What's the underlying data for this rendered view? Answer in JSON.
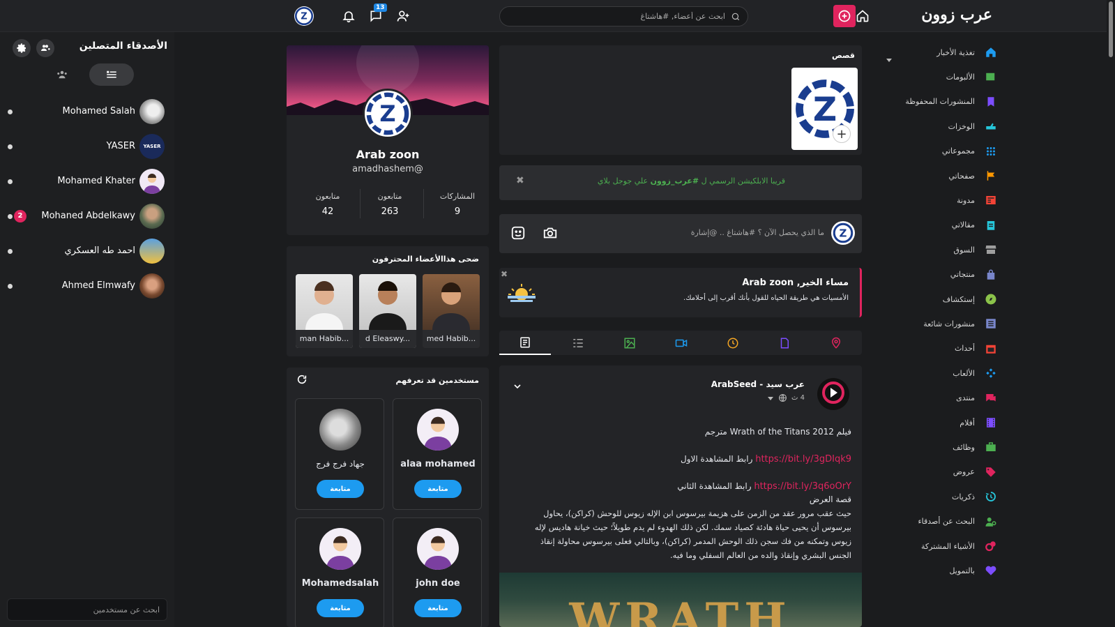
{
  "topbar": {
    "logo": "عرب زوون",
    "search_placeholder": "ابحث عن أعضاء, #هاشتاغ",
    "messages_count": "13"
  },
  "colors": {
    "accent": "#e0245e",
    "blue": "#1d9bf0",
    "bg": "#1b1c1e",
    "card": "#232427"
  },
  "left_sidebar": {
    "title": "الأصدقاء المتصلين",
    "search_placeholder": "ابحث عن مستخدمين",
    "friends": [
      {
        "name": "Mohamed Salah",
        "unread": ""
      },
      {
        "name": "YASER",
        "unread": ""
      },
      {
        "name": "Mohamed Khater",
        "unread": ""
      },
      {
        "name": "Mohaned Abdelkawy",
        "unread": "2"
      },
      {
        "name": "احمد طه العسكري",
        "unread": ""
      },
      {
        "name": "Ahmed Elmwafy",
        "unread": ""
      }
    ]
  },
  "profile": {
    "name": "Arab zoon",
    "handle": "amadhashem@",
    "stats": [
      {
        "label": "المشاركات",
        "value": "9"
      },
      {
        "label": "متابعون",
        "value": "263"
      },
      {
        "label": "متابعون",
        "value": "42"
      }
    ]
  },
  "featured": {
    "title": "ضحى هذاالأعضاء المحترفون",
    "members": [
      "med Habib...",
      "d Eleaswy...",
      "man Habib..."
    ]
  },
  "suggestions": {
    "title": "مستخدمين قد تعرفهم",
    "follow_label": "متابعة",
    "users": [
      "alaa mohamed",
      "جهاد فرج فرج",
      "john doe",
      "Mohamedsalah"
    ]
  },
  "stories": {
    "title": "قصص"
  },
  "announcement": {
    "prefix": "قريبا الابلكيشن الرسمي ل",
    "hashtag": "#عرب_زوون",
    "suffix": "علي جوجل بلاي"
  },
  "composer": {
    "placeholder": "ما الذي يحصل الآن ؟ #هاشتاغ .. @إشارة"
  },
  "greeting": {
    "title": "مساء الخير, Arab zoon",
    "quote": "الأمسيات هي طريقة الحياه للقول بأنك أقرب إلى أحلامك."
  },
  "post": {
    "author": "عرب سيد - ArabSeed",
    "time": "4 ث",
    "line1": "فيلم Wrath of the Titans 2012 مترجم",
    "link1_label": "رابط المشاهدة الاول",
    "link1": "https://bit.ly/3gDIqk9",
    "link2_label": "رابط المشاهدة الثاني",
    "link2": "https://bit.ly/3q6oOrY",
    "story_title": "قصة العرض",
    "story": "حيث عقب مرور عقد من الزمن على هزيمة بيرسوس ابن الإله زيوس للوحش (كراكن)، يحاول بيرسوس أن يحيى حياة هادئة كصياد سمك. لكن ذلك الهدوء لم يدم طويلاً؛ حيث خيانة هاديس لإله زيوس وتمكنه من فك سجن ذلك الوحش المدمر (كراكن)، وبالتالي فعلى بيرسوس محاولة إنقاذ الجنس البشري وإنقاذ والده من العالم السفلي وما فيه.",
    "image_text": "WRATH"
  },
  "right_nav": [
    {
      "label": "تغذية الأخبار",
      "icon": "home-icon",
      "color": "#1d9bf0"
    },
    {
      "label": "الألبومات",
      "icon": "album-icon",
      "color": "#4caf50"
    },
    {
      "label": "المنشورات المحفوظة",
      "icon": "bookmark-icon",
      "color": "#7c4dff"
    },
    {
      "label": "الوخزات",
      "icon": "poke-icon",
      "color": "#26c6da"
    },
    {
      "label": "مجموعاتي",
      "icon": "groups-icon",
      "color": "#1d9bf0"
    },
    {
      "label": "صفحاتي",
      "icon": "flag-icon",
      "color": "#ff9800"
    },
    {
      "label": "مدونة",
      "icon": "blog-icon",
      "color": "#f44336"
    },
    {
      "label": "مقالاتي",
      "icon": "clipboard-icon",
      "color": "#26c6da"
    },
    {
      "label": "السوق",
      "icon": "store-icon",
      "color": "#9e9e9e"
    },
    {
      "label": "منتجاتي",
      "icon": "bag-icon",
      "color": "#7986cb"
    },
    {
      "label": "إستكشاف",
      "icon": "compass-icon",
      "color": "#8bc34a"
    },
    {
      "label": "منشورات شائعة",
      "icon": "list-icon",
      "color": "#7986cb"
    },
    {
      "label": "أحداث",
      "icon": "calendar-icon",
      "color": "#f44336"
    },
    {
      "label": "الألعاب",
      "icon": "game-icon",
      "color": "#1d9bf0"
    },
    {
      "label": "منتدى",
      "icon": "forum-icon",
      "color": "#e0245e"
    },
    {
      "label": "أفلام",
      "icon": "film-icon",
      "color": "#7c4dff"
    },
    {
      "label": "وظائف",
      "icon": "briefcase-icon",
      "color": "#4caf50"
    },
    {
      "label": "عروض",
      "icon": "tag-icon",
      "color": "#e0245e"
    },
    {
      "label": "ذكريات",
      "icon": "history-icon",
      "color": "#26c6da"
    },
    {
      "label": "البحث عن أصدقاء",
      "icon": "find-friends-icon",
      "color": "#4caf50"
    },
    {
      "label": "الأشياء المشتركة",
      "icon": "common-things-icon",
      "color": "#e0245e"
    },
    {
      "label": "بالتمويل",
      "icon": "funding-icon",
      "color": "#7c4dff"
    }
  ]
}
